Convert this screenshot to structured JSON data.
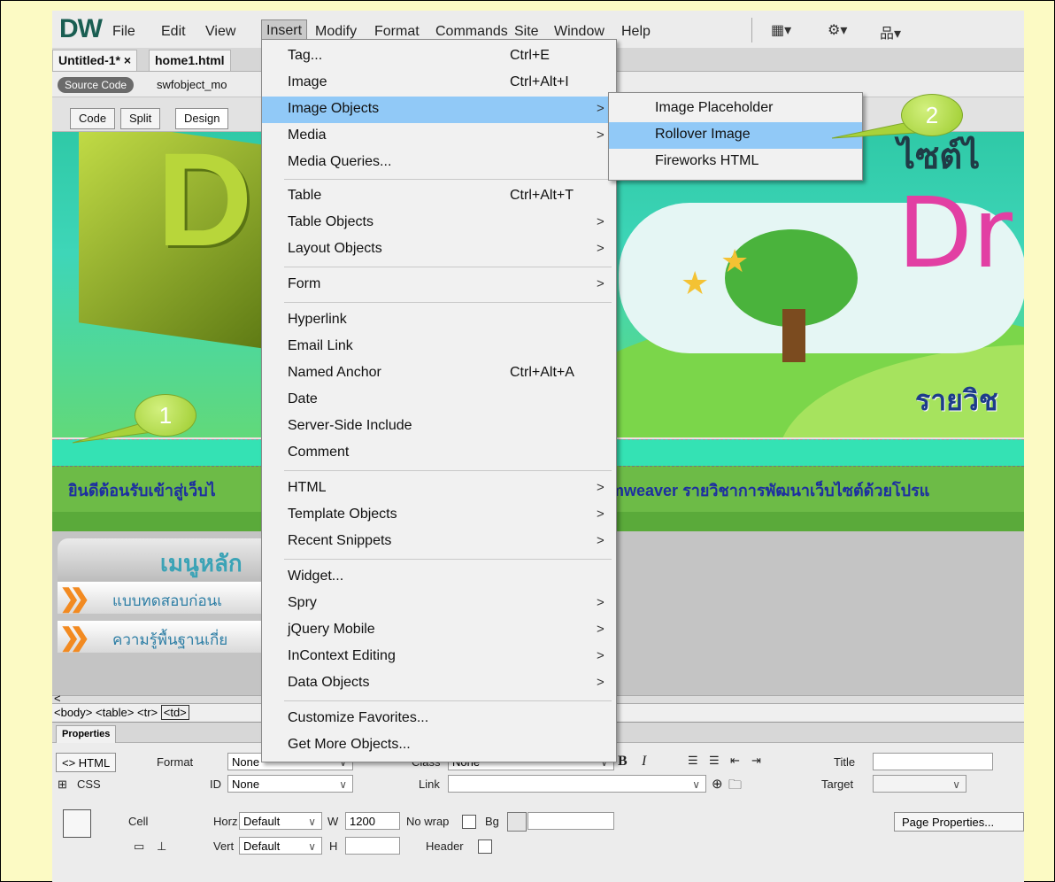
{
  "menubar": {
    "logo": "DW",
    "items": [
      "File",
      "Edit",
      "View",
      "Insert",
      "Modify",
      "Format",
      "Commands",
      "Site",
      "Window",
      "Help"
    ],
    "active_item": "Insert",
    "icons": [
      "layout-icon",
      "gear-icon",
      "sitemap-icon"
    ]
  },
  "tabs": [
    "Untitled-1* ×",
    "home1.html"
  ],
  "related": {
    "source_code": "Source Code",
    "file": "swfobject_mo"
  },
  "view_buttons": [
    "Code",
    "Split",
    "Design"
  ],
  "insert_menu": {
    "items": [
      {
        "label": "Tag...",
        "shortcut": "Ctrl+E"
      },
      {
        "label": "Image",
        "shortcut": "Ctrl+Alt+I"
      },
      {
        "label": "Image Objects",
        "arrow": ">"
      },
      {
        "label": "Media",
        "arrow": ">"
      },
      {
        "label": "Media Queries..."
      },
      {
        "label": "Table",
        "shortcut": "Ctrl+Alt+T"
      },
      {
        "label": "Table Objects",
        "arrow": ">"
      },
      {
        "label": "Layout Objects",
        "arrow": ">"
      },
      {
        "label": "Form",
        "arrow": ">"
      },
      {
        "label": "Hyperlink"
      },
      {
        "label": "Email Link"
      },
      {
        "label": "Named Anchor",
        "shortcut": "Ctrl+Alt+A"
      },
      {
        "label": "Date"
      },
      {
        "label": "Server-Side Include"
      },
      {
        "label": "Comment"
      },
      {
        "label": "HTML",
        "arrow": ">"
      },
      {
        "label": "Template Objects",
        "arrow": ">"
      },
      {
        "label": "Recent Snippets",
        "arrow": ">"
      },
      {
        "label": "Widget..."
      },
      {
        "label": "Spry",
        "arrow": ">"
      },
      {
        "label": "jQuery Mobile",
        "arrow": ">"
      },
      {
        "label": "InContext Editing",
        "arrow": ">"
      },
      {
        "label": "Data Objects",
        "arrow": ">"
      },
      {
        "label": "Customize Favorites..."
      },
      {
        "label": "Get More Objects..."
      }
    ],
    "highlighted": "Image Objects"
  },
  "image_objects_submenu": {
    "items": [
      "Image Placeholder",
      "Rollover Image",
      "Fireworks HTML"
    ],
    "highlighted": "Rollover Image"
  },
  "page_content": {
    "banner_thai_top": "ไซต์ไ",
    "banner_dr": "Dr",
    "banner_thai_right": "รายวิช",
    "welcome_text": "ยินดีต้อนรับเข้าสู่เว็บไ",
    "welcome_text_right": "amweaver รายวิชาการพัฒนาเว็บไซต์ด้วยโปรแ",
    "menu_heading": "เมนูหลัก",
    "menu_items": [
      "แบบทดสอบก่อนเ",
      "ความรู้พื้นฐานเกี่ย"
    ]
  },
  "tag_selector": {
    "body": "<body>",
    "table": "<table>",
    "tr": "<tr>",
    "td": "<td>"
  },
  "properties": {
    "tab": "Properties",
    "html_btn": "<> HTML",
    "css_btn": "CSS",
    "format_label": "Format",
    "format_value": "None",
    "id_label": "ID",
    "id_value": "None",
    "class_label": "Class",
    "class_value": "None",
    "link_label": "Link",
    "bold": "B",
    "italic": "I",
    "title_label": "Title",
    "target_label": "Target",
    "cell_label": "Cell",
    "horz_label": "Horz",
    "horz_value": "Default",
    "vert_label": "Vert",
    "vert_value": "Default",
    "w_label": "W",
    "w_value": "1200",
    "h_label": "H",
    "nowrap_label": "No wrap",
    "bg_label": "Bg",
    "header_label": "Header",
    "page_props": "Page Properties..."
  },
  "callouts": [
    "1",
    "2"
  ],
  "colors": {
    "highlight": "#91c9f7",
    "callout": "#a8d23a",
    "page_bg": "#fcfac4"
  }
}
